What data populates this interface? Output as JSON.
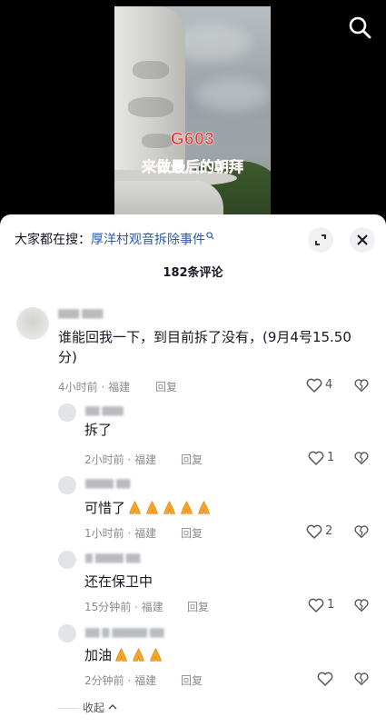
{
  "video": {
    "caption_line1": "G603",
    "caption_line2": "来做最后的朝拜"
  },
  "header": {
    "search_prefix": "大家都在搜：",
    "search_keyword": "厚洋村观音拆除事件",
    "comment_count": "182条评论"
  },
  "comments": [
    {
      "text": "谁能回我一下，到目前拆了没有，(9月4号15.50分)",
      "time": "4小时前 · 福建",
      "reply": "回复",
      "likes": "4"
    },
    {
      "text": "拆了",
      "time": "2小时前 · 福建",
      "reply": "回复",
      "likes": "1"
    },
    {
      "text": "可惜了",
      "time": "1小时前 · 福建",
      "reply": "回复",
      "likes": "2"
    },
    {
      "text": "还在保卫中",
      "time": "15分钟前 · 福建",
      "reply": "回复",
      "likes": "1"
    },
    {
      "text": "加油",
      "time": "2分钟前 · 福建",
      "reply": "回复",
      "likes": ""
    }
  ],
  "collapse_label": "收起",
  "icons": {
    "search": "search-icon",
    "expand": "expand-icon",
    "close": "close-icon",
    "like": "heart-outline-icon",
    "dislike": "broken-heart-icon",
    "pray": "praying-hands-emoji"
  },
  "colors": {
    "keyword": "#2b5aa8",
    "caption": "#e8332a",
    "meta": "#8a8b91"
  }
}
